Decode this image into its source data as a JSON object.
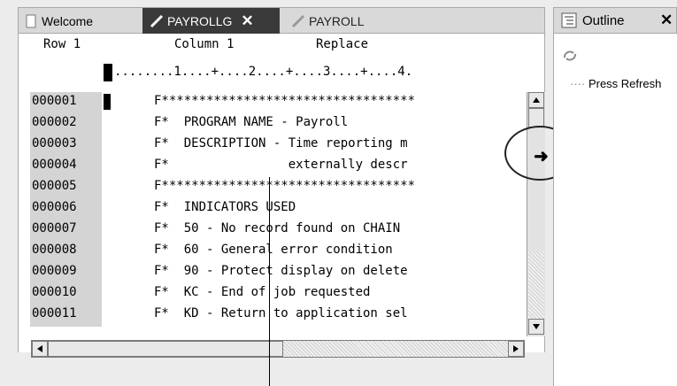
{
  "tabs": {
    "welcome": "Welcome",
    "payrollg": "PAYROLLG",
    "payroll": "PAYROLL",
    "close_glyph": "✕"
  },
  "editor": {
    "row_label": "Row 1",
    "column_label": "Column 1",
    "mode": "Replace",
    "ruler": "........1....+....2....+....3....+....4.",
    "lines": [
      {
        "seq": "000001",
        "text": "F**********************************"
      },
      {
        "seq": "000002",
        "text": "F*  PROGRAM NAME - Payroll"
      },
      {
        "seq": "000003",
        "text": "F*  DESCRIPTION - Time reporting m"
      },
      {
        "seq": "000004",
        "text": "F*                externally descr"
      },
      {
        "seq": "000005",
        "text": "F**********************************"
      },
      {
        "seq": "000006",
        "text": "F*  INDICATORS USED"
      },
      {
        "seq": "000007",
        "text": "F*  50 - No record found on CHAIN"
      },
      {
        "seq": "000008",
        "text": "F*  60 - General error condition"
      },
      {
        "seq": "000009",
        "text": "F*  90 - Protect display on delete"
      },
      {
        "seq": "000010",
        "text": "F*  KC - End of job requested"
      },
      {
        "seq": "000011",
        "text": "F*  KD - Return to application sel"
      }
    ]
  },
  "outline": {
    "title": "Outline",
    "close_glyph": "✕",
    "item": "Press Refresh"
  }
}
